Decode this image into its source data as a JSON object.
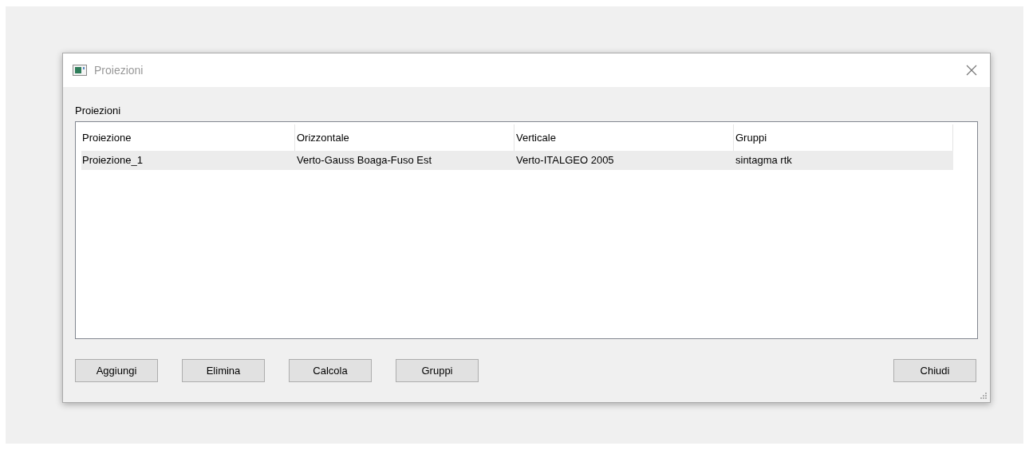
{
  "window": {
    "title": "Proiezioni"
  },
  "group_label": "Proiezioni",
  "table": {
    "columns": [
      "Proiezione",
      "Orizzontale",
      "Verticale",
      "Gruppi"
    ],
    "rows": [
      {
        "cells": [
          "Proiezione_1",
          "Verto-Gauss Boaga-Fuso Est",
          "Verto-ITALGEO 2005",
          "sintagma rtk"
        ],
        "selected": true
      }
    ]
  },
  "buttons": [
    "Aggiungi",
    "Elimina",
    "Calcola",
    "Gruppi"
  ],
  "close_button": "Chiudi"
}
